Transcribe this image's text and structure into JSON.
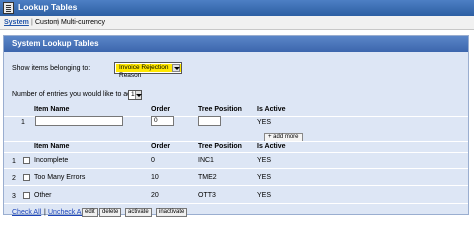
{
  "window": {
    "title": "Lookup Tables"
  },
  "tabs": [
    {
      "label": "System"
    },
    {
      "label": "Custom"
    },
    {
      "label": "Multi-currency"
    }
  ],
  "tab_separator": "|",
  "panel": {
    "title": "System Lookup Tables",
    "show_items_label": "Show items belonging to:",
    "show_items_value": "Invoice Rejection Reason",
    "entries_label": "Number of entries you would like to add:",
    "entries_value": "1"
  },
  "new_entry": {
    "headers": {
      "item_name": "Item Name",
      "order": "Order",
      "tree_position": "Tree Position",
      "is_active": "Is Active"
    },
    "row_number": "1",
    "item_name_value": "",
    "order_value": "0",
    "tree_position_value": "",
    "is_active": "YES",
    "add_more_label": "+ add more"
  },
  "table": {
    "headers": {
      "item_name": "Item Name",
      "order": "Order",
      "tree_position": "Tree Position",
      "is_active": "Is Active"
    },
    "rows": [
      {
        "num": "1",
        "item_name": "Incomplete",
        "order": "0",
        "tree_position": "INC1",
        "is_active": "YES"
      },
      {
        "num": "2",
        "item_name": "Too Many Errors",
        "order": "10",
        "tree_position": "TME2",
        "is_active": "YES"
      },
      {
        "num": "3",
        "item_name": "Other",
        "order": "20",
        "tree_position": "OTT3",
        "is_active": "YES"
      }
    ]
  },
  "actions": {
    "check_all": "Check All",
    "separator": "|",
    "uncheck_all": "Uncheck All",
    "edit": "edit",
    "delete": "delete",
    "activate": "activate",
    "inactivate": "inactivate"
  }
}
